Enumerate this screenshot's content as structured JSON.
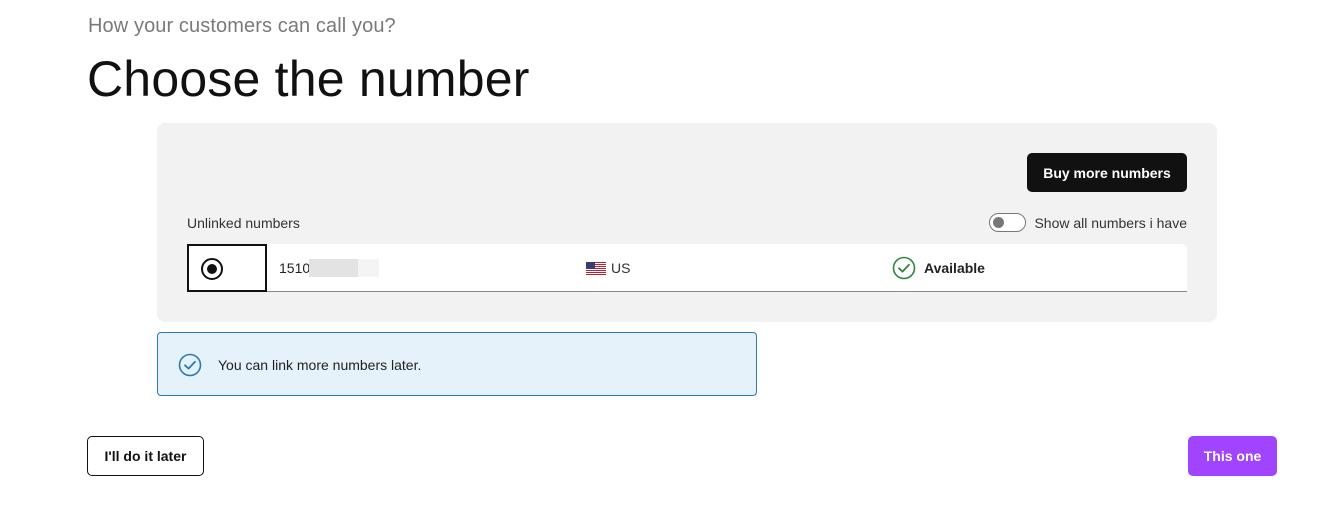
{
  "header": {
    "subtitle": "How your customers can call you?",
    "title": "Choose the number"
  },
  "panel": {
    "buy_button_label": "Buy more numbers",
    "section_label": "Unlinked numbers",
    "toggle": {
      "label": "Show all numbers i have",
      "on": false
    },
    "numbers": [
      {
        "selected": true,
        "number_visible": "1510",
        "country_icon": "us-flag-icon",
        "country": "US",
        "status_icon": "check-circle-icon",
        "status": "Available"
      }
    ]
  },
  "info": {
    "icon": "check-circle-icon",
    "text": "You can link more numbers later."
  },
  "footer": {
    "later_label": "I'll do it later",
    "confirm_label": "This one"
  },
  "colors": {
    "primary": "#a044ff",
    "dark": "#111111",
    "panel_bg": "#f2f2f2",
    "info_bg": "#e5f2fa",
    "info_border": "#2a7ab0",
    "success": "#2e8540"
  }
}
